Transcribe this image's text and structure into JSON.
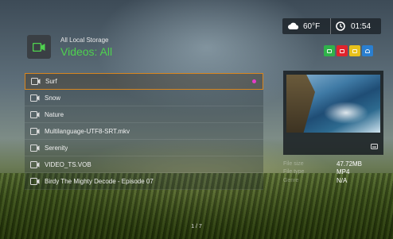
{
  "header": {
    "breadcrumb": "All Local Storage",
    "title": "Videos: All",
    "title_color": "#4fd14f",
    "icon": "video-camera-icon"
  },
  "status": {
    "weather_icon": "cloud-icon",
    "temperature": "60°F",
    "clock_icon": "clock-icon",
    "time": "01:54"
  },
  "color_buttons": [
    {
      "name": "green",
      "color": "#2fb24a"
    },
    {
      "name": "red",
      "color": "#e0232c"
    },
    {
      "name": "yellow",
      "color": "#e8c11c"
    },
    {
      "name": "blue",
      "color": "#2a7fd0"
    }
  ],
  "files": [
    {
      "name": "Surf",
      "selected": true
    },
    {
      "name": "Snow",
      "selected": false
    },
    {
      "name": "Nature",
      "selected": false
    },
    {
      "name": "Multilanguage-UTF8-SRT.mkv",
      "selected": false
    },
    {
      "name": "Serenity",
      "selected": false
    },
    {
      "name": "VIDEO_TS.VOB",
      "selected": false
    },
    {
      "name": "Birdy The Mighty Decode - Episode 07",
      "selected": false
    }
  ],
  "details": {
    "file_size_label": "File size",
    "file_size": "47.72MB",
    "file_type_label": "File type",
    "file_type": "MP4",
    "genre_label": "Genre",
    "genre": "N/A"
  },
  "pagination": "1 / 7",
  "accent_color": "#d8851e"
}
